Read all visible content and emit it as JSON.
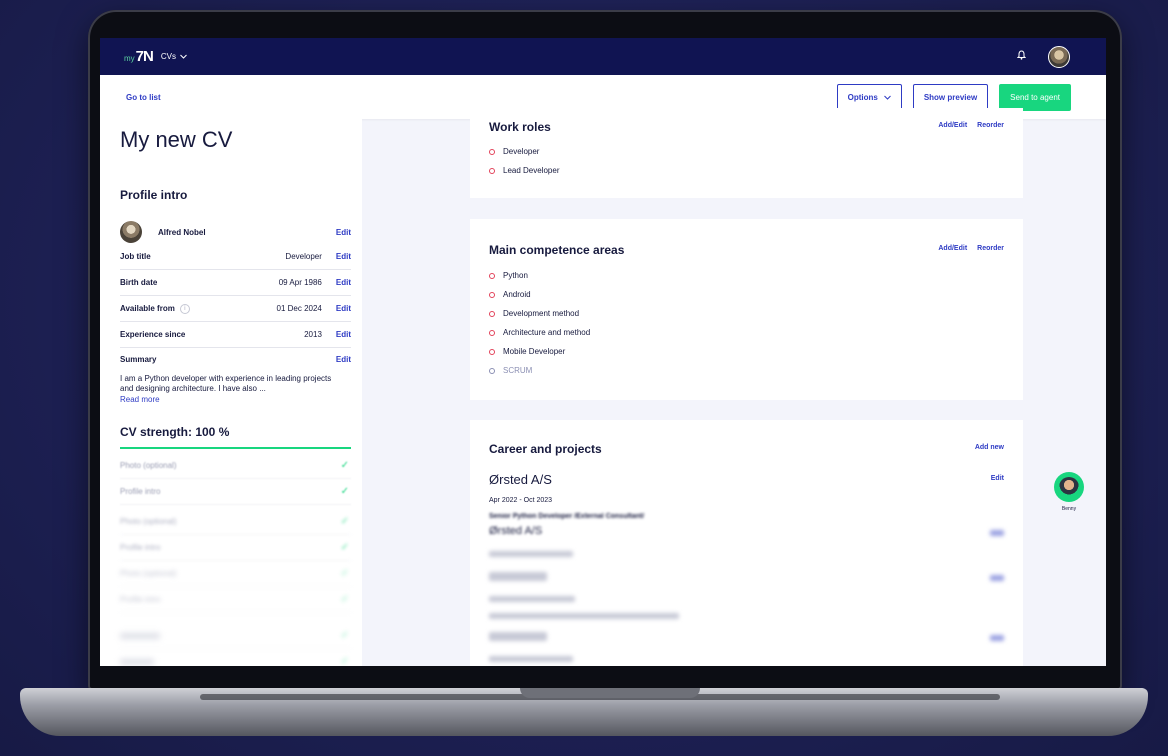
{
  "topbar": {
    "logo_text": "7N",
    "logo_prefix": "my",
    "section_label": "CVs"
  },
  "actionbar": {
    "goto_list": "Go to list",
    "options": "Options",
    "show_preview": "Show preview",
    "send_to_agent": "Send to agent"
  },
  "cv": {
    "title": "My new CV"
  },
  "profile": {
    "heading": "Profile intro",
    "name": "Alfred Nobel",
    "edit": "Edit",
    "rows": [
      {
        "label": "Job title",
        "value": "Developer"
      },
      {
        "label": "Birth date",
        "value": "09 Apr 1986"
      },
      {
        "label": "Available from",
        "value": "01 Dec 2024"
      },
      {
        "label": "Experience since",
        "value": "2013"
      }
    ],
    "summary_label": "Summary",
    "summary_text": "I am a Python developer with experience in leading projects and designing architecture. I have also ...",
    "read_more": "Read more"
  },
  "strength": {
    "heading": "CV strength: 100 %",
    "level": 1.0,
    "items": [
      "Photo (optional)",
      "Profile intro",
      "Photo (optional)",
      "Profile intro",
      "Photo (optional)",
      "Profile intro"
    ]
  },
  "work_roles": {
    "heading": "Work roles",
    "add_edit": "Add/Edit",
    "reorder": "Reorder",
    "items": [
      "Developer",
      "Lead Developer"
    ]
  },
  "competence": {
    "heading": "Main competence areas",
    "add_edit": "Add/Edit",
    "reorder": "Reorder",
    "items": [
      "Python",
      "Android",
      "Development method",
      "Architecture and method",
      "Mobile Developer",
      "SCRUM"
    ]
  },
  "career": {
    "heading": "Career and projects",
    "add_new": "Add new",
    "company": "Ørsted A/S",
    "edit": "Edit",
    "period": "Apr 2022 - Oct 2023",
    "role": "Senior Python Developer /External Consultant/",
    "company2": "Ørsted A/S"
  },
  "agent": {
    "name": "Benny"
  },
  "colors": {
    "navy": "#101452",
    "accent_green": "#18d67f",
    "link_blue": "#2e3bc4",
    "bullet_red": "#e2425a"
  }
}
